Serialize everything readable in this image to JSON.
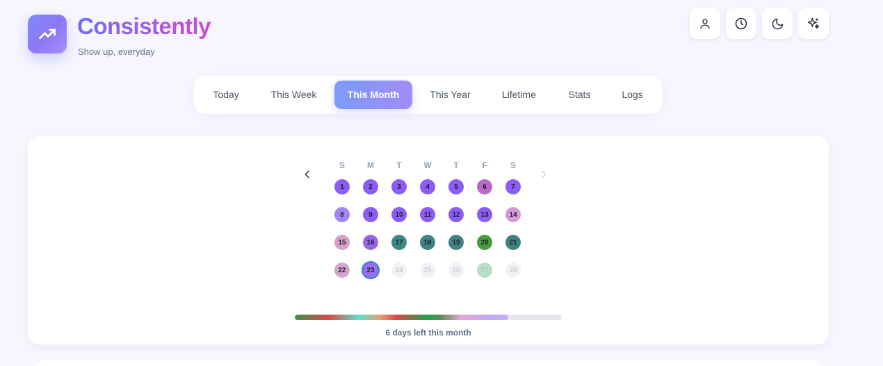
{
  "header": {
    "title": "Consistently",
    "subtitle": "Show up, everyday",
    "logo_icon": "trending-up-icon",
    "actions": [
      {
        "name": "profile",
        "icon": "user-icon"
      },
      {
        "name": "history",
        "icon": "clock-icon"
      },
      {
        "name": "theme",
        "icon": "moon-icon"
      },
      {
        "name": "magic",
        "icon": "sparkles-icon"
      }
    ]
  },
  "tabs": [
    {
      "label": "Today",
      "active": false
    },
    {
      "label": "This Week",
      "active": false
    },
    {
      "label": "This Month",
      "active": true
    },
    {
      "label": "This Year",
      "active": false
    },
    {
      "label": "Lifetime",
      "active": false
    },
    {
      "label": "Stats",
      "active": false
    },
    {
      "label": "Logs",
      "active": false
    }
  ],
  "calendar": {
    "weekdays": [
      "S",
      "M",
      "T",
      "W",
      "T",
      "F",
      "S"
    ],
    "prev_icon": "chevron-left-icon",
    "next_icon": "chevron-right-icon",
    "days": [
      {
        "label": "1",
        "color": "#8b5cf6"
      },
      {
        "label": "2",
        "color": "#8b5cf6"
      },
      {
        "label": "3",
        "color": "#8b5cf6"
      },
      {
        "label": "4",
        "color": "#8b5cf6"
      },
      {
        "label": "5",
        "color": "#8b5cf6"
      },
      {
        "label": "6",
        "color": "#b96ac8"
      },
      {
        "label": "7",
        "color": "#8b5cf6"
      },
      {
        "label": "8",
        "color": "#a285f0"
      },
      {
        "label": "9",
        "color": "#8b5cf6"
      },
      {
        "label": "10",
        "color": "#8b5cf6"
      },
      {
        "label": "11",
        "color": "#8b5cf6"
      },
      {
        "label": "12",
        "color": "#8b5cf6"
      },
      {
        "label": "13",
        "color": "#8b5cf6"
      },
      {
        "label": "14",
        "color": "#d39ad9"
      },
      {
        "label": "15",
        "color": "#d7a0c8"
      },
      {
        "label": "16",
        "color": "#9766e8"
      },
      {
        "label": "17",
        "color": "#3d8a84"
      },
      {
        "label": "18",
        "color": "#3f8383"
      },
      {
        "label": "19",
        "color": "#438384"
      },
      {
        "label": "20",
        "color": "#4a9a3e"
      },
      {
        "label": "21",
        "color": "#3f837e"
      },
      {
        "label": "22",
        "color": "#d4a6cc"
      },
      {
        "label": "23",
        "color": "#9b6ff0",
        "today": true
      },
      {
        "label": "24",
        "future": true
      },
      {
        "label": "25",
        "future": true
      },
      {
        "label": "26",
        "future": true
      },
      {
        "label": "27",
        "color": "#b8e0c8",
        "future": true
      },
      {
        "label": "28",
        "future": true
      }
    ]
  },
  "progress": {
    "fraction": 0.8,
    "caption": "6 days left this month"
  }
}
